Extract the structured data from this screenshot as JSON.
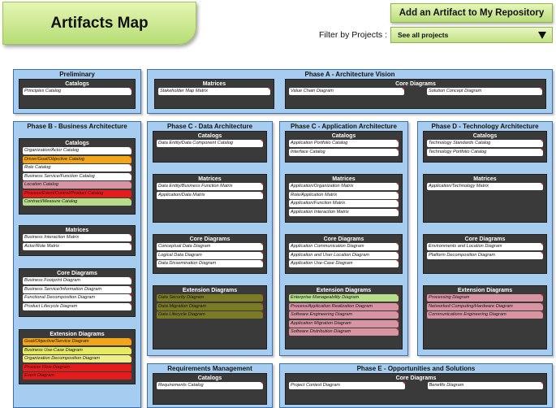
{
  "header": {
    "title": "Artifacts Map",
    "add_button": "Add an Artifact to My Repository",
    "filter_label": "Filter by Projects :",
    "filter_value": "See all projects"
  },
  "colors": {
    "white": "#ffffff",
    "orange": "#f3a519",
    "yellow": "#e6ea62",
    "pink": "#d994a4",
    "red": "#e41c1c",
    "olive": "#7b7a25",
    "green": "#b7dd8a",
    "light_yellow": "#eeef8a"
  },
  "phases": {
    "preliminary": {
      "title": "Preliminary",
      "catalogs": {
        "title": "Catalogs",
        "items": [
          {
            "label": "Principles Catalog",
            "color": "white"
          }
        ]
      }
    },
    "phase_a": {
      "title": "Phase A - Architecture Vision",
      "matrices": {
        "title": "Matrices",
        "items": [
          {
            "label": "Stakeholder Map Matrix",
            "color": "white"
          }
        ]
      },
      "core": {
        "title": "Core Diagrams",
        "items": [
          {
            "label": "Value Chain Diagram",
            "color": "white"
          },
          {
            "label": "Solution Concept Diagram",
            "color": "white"
          }
        ]
      }
    },
    "phase_b": {
      "title": "Phase B - Business Architecture",
      "catalogs": {
        "title": "Catalogs",
        "items": [
          {
            "label": "Organization/Actor Catalog",
            "color": "white"
          },
          {
            "label": "Driver/Goal/Objective Catalog",
            "color": "orange"
          },
          {
            "label": "Role Catalog",
            "color": "white"
          },
          {
            "label": "Business Service/Function Catalog",
            "color": "white"
          },
          {
            "label": "Location Catalog",
            "color": "pink"
          },
          {
            "label": "Process/Event/Control/Product Catalog",
            "color": "red"
          },
          {
            "label": "Contract/Measure Catalog",
            "color": "green"
          }
        ]
      },
      "matrices": {
        "title": "Matrices",
        "items": [
          {
            "label": "Business Interaction Matrix",
            "color": "white"
          },
          {
            "label": "Actor/Role Matrix",
            "color": "white"
          }
        ]
      },
      "core": {
        "title": "Core Diagrams",
        "items": [
          {
            "label": "Business Footprint Diagram",
            "color": "white"
          },
          {
            "label": "Business Service/Information Diagram",
            "color": "white"
          },
          {
            "label": "Functional Decomposition Diagram",
            "color": "white"
          },
          {
            "label": "Product Lifecycle Diagram",
            "color": "white"
          }
        ]
      },
      "extension": {
        "title": "Extension Diagrams",
        "items": [
          {
            "label": "Goal/Objective/Service Diagram",
            "color": "orange"
          },
          {
            "label": "Business Use-Case Diagram",
            "color": "yellow"
          },
          {
            "label": "Organization Decomposition Diagram",
            "color": "light_yellow"
          },
          {
            "label": "Process Flow Diagram",
            "color": "red"
          },
          {
            "label": "Event Diagram",
            "color": "red"
          }
        ]
      }
    },
    "phase_c_data": {
      "title": "Phase C - Data Architecture",
      "catalogs": {
        "title": "Catalogs",
        "items": [
          {
            "label": "Data Entity/Data Component Catalog",
            "color": "white"
          }
        ]
      },
      "matrices": {
        "title": "Matrices",
        "items": [
          {
            "label": "Data Entity/Business Function Matrix",
            "color": "white"
          },
          {
            "label": "Application/Data Matrix",
            "color": "white"
          }
        ]
      },
      "core": {
        "title": "Core Diagrams",
        "items": [
          {
            "label": "Conceptual Data Diagram",
            "color": "white"
          },
          {
            "label": "Logical Data Diagram",
            "color": "white"
          },
          {
            "label": "Data Dissemination Diagram",
            "color": "white"
          }
        ]
      },
      "extension": {
        "title": "Extension Diagrams",
        "items": [
          {
            "label": "Data Security Diagram",
            "color": "olive"
          },
          {
            "label": "Data Migration Diagram",
            "color": "olive"
          },
          {
            "label": "Data Lifecycle Diagram",
            "color": "olive"
          }
        ]
      }
    },
    "phase_c_app": {
      "title": "Phase C - Application Architecture",
      "catalogs": {
        "title": "Catalogs",
        "items": [
          {
            "label": "Application Portfolio Catalog",
            "color": "white"
          },
          {
            "label": "Interface Catalog",
            "color": "white"
          }
        ]
      },
      "matrices": {
        "title": "Matrices",
        "items": [
          {
            "label": "Application/Organization Matrix",
            "color": "white"
          },
          {
            "label": "Role/Application Matrix",
            "color": "white"
          },
          {
            "label": "Application/Function Matrix",
            "color": "white"
          },
          {
            "label": "Application Interaction Matrix",
            "color": "white"
          }
        ]
      },
      "core": {
        "title": "Core Diagrams",
        "items": [
          {
            "label": "Application Communication Diagram",
            "color": "white"
          },
          {
            "label": "Application and User Location Diagram",
            "color": "white"
          },
          {
            "label": "Application Use-Case Diagram",
            "color": "white"
          }
        ]
      },
      "extension": {
        "title": "Extension Diagrams",
        "items": [
          {
            "label": "Enterprise Manageability Diagram",
            "color": "green"
          },
          {
            "label": "Process/Application Realization Diagram",
            "color": "pink"
          },
          {
            "label": "Software Engineering Diagram",
            "color": "pink"
          },
          {
            "label": "Application Migration Diagram",
            "color": "pink"
          },
          {
            "label": "Software Distribution Diagram",
            "color": "pink"
          }
        ]
      }
    },
    "phase_d": {
      "title": "Phase D - Technology Architecture",
      "catalogs": {
        "title": "Catalogs",
        "items": [
          {
            "label": "Technology Standards Catalog",
            "color": "white"
          },
          {
            "label": "Technology Portfolio Catalog",
            "color": "white"
          }
        ]
      },
      "matrices": {
        "title": "Matrices",
        "items": [
          {
            "label": "Application/Technology Matrix",
            "color": "white"
          }
        ]
      },
      "core": {
        "title": "Core Diagrams",
        "items": [
          {
            "label": "Environments and Location Diagram",
            "color": "white"
          },
          {
            "label": "Platform Decomposition Diagram",
            "color": "white"
          }
        ]
      },
      "extension": {
        "title": "Extension Diagrams",
        "items": [
          {
            "label": "Processing Diagram",
            "color": "pink"
          },
          {
            "label": "Networked Computing/Hardware Diagram",
            "color": "pink"
          },
          {
            "label": "Communications Engineering Diagram",
            "color": "pink"
          }
        ]
      }
    },
    "requirements": {
      "title": "Requirements Management",
      "catalogs": {
        "title": "Catalogs",
        "items": [
          {
            "label": "Requirements Catalog",
            "color": "white"
          }
        ]
      }
    },
    "phase_e": {
      "title": "Phase E - Opportunities and Solutions",
      "core": {
        "title": "Core Diagrams",
        "items": [
          {
            "label": "Project Context Diagram",
            "color": "white"
          },
          {
            "label": "Benefits Diagram",
            "color": "white"
          }
        ]
      }
    }
  }
}
